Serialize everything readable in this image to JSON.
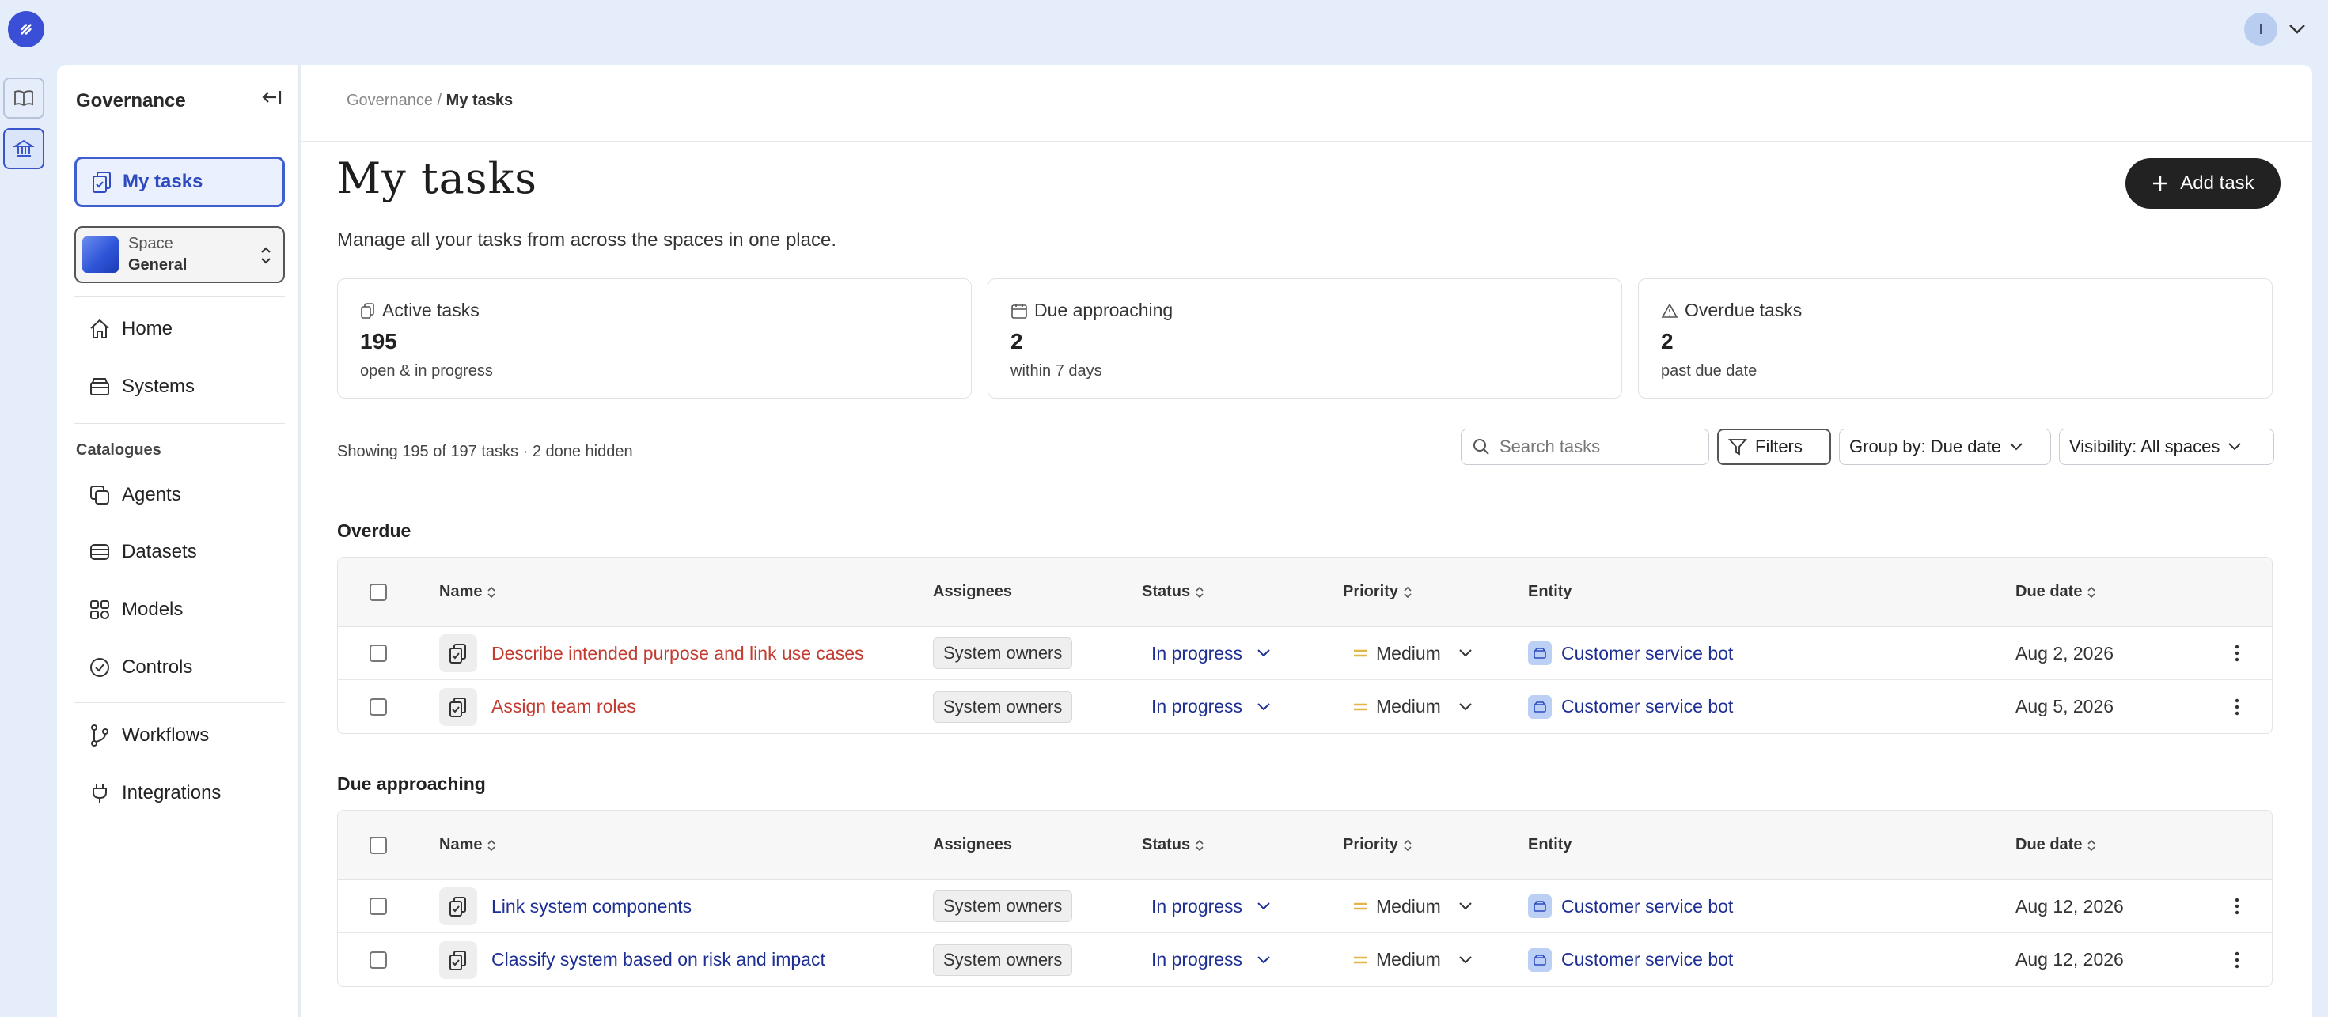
{
  "user": {
    "initial": "I"
  },
  "sidebar": {
    "title": "Governance",
    "my_tasks": "My tasks",
    "space": {
      "label": "Space",
      "value": "General"
    },
    "nav": [
      "Home",
      "Systems"
    ],
    "catalogues_label": "Catalogues",
    "catalogues": [
      "Agents",
      "Datasets",
      "Models",
      "Controls"
    ],
    "extra": [
      "Workflows",
      "Integrations"
    ]
  },
  "breadcrumb": {
    "parent": "Governance",
    "separator": "/",
    "current": "My tasks"
  },
  "page": {
    "title": "My tasks",
    "subtitle": "Manage all your tasks from across the spaces in one place.",
    "add_button": "Add task"
  },
  "stats": [
    {
      "label": "Active tasks",
      "value": "195",
      "sub": "open & in progress"
    },
    {
      "label": "Due approaching",
      "value": "2",
      "sub": "within 7 days"
    },
    {
      "label": "Overdue tasks",
      "value": "2",
      "sub": "past due date"
    }
  ],
  "toolbar": {
    "showing": "Showing 195 of 197 tasks · 2 done hidden",
    "search_placeholder": "Search tasks",
    "filters": "Filters",
    "group_by": "Group by: Due date",
    "visibility": "Visibility: All spaces"
  },
  "columns": {
    "name": "Name",
    "assignees": "Assignees",
    "status": "Status",
    "priority": "Priority",
    "entity": "Entity",
    "due": "Due date"
  },
  "groups": [
    {
      "title": "Overdue",
      "rows": [
        {
          "name": "Describe intended purpose and link use cases",
          "assignee": "System owners",
          "status": "In progress",
          "priority": "Medium",
          "entity": "Customer service bot",
          "due": "Aug 2, 2026"
        },
        {
          "name": "Assign team roles",
          "assignee": "System owners",
          "status": "In progress",
          "priority": "Medium",
          "entity": "Customer service bot",
          "due": "Aug 5, 2026"
        }
      ]
    },
    {
      "title": "Due approaching",
      "rows": [
        {
          "name": "Link system components",
          "assignee": "System owners",
          "status": "In progress",
          "priority": "Medium",
          "entity": "Customer service bot",
          "due": "Aug 12, 2026"
        },
        {
          "name": "Classify system based on risk and impact",
          "assignee": "System owners",
          "status": "In progress",
          "priority": "Medium",
          "entity": "Customer service bot",
          "due": "Aug 12, 2026"
        }
      ]
    }
  ],
  "colors": {
    "accent": "#3d5fd0",
    "overdue_text": "#c23b30",
    "link_text": "#1e2f94",
    "priority_medium": "#e0b64a"
  }
}
